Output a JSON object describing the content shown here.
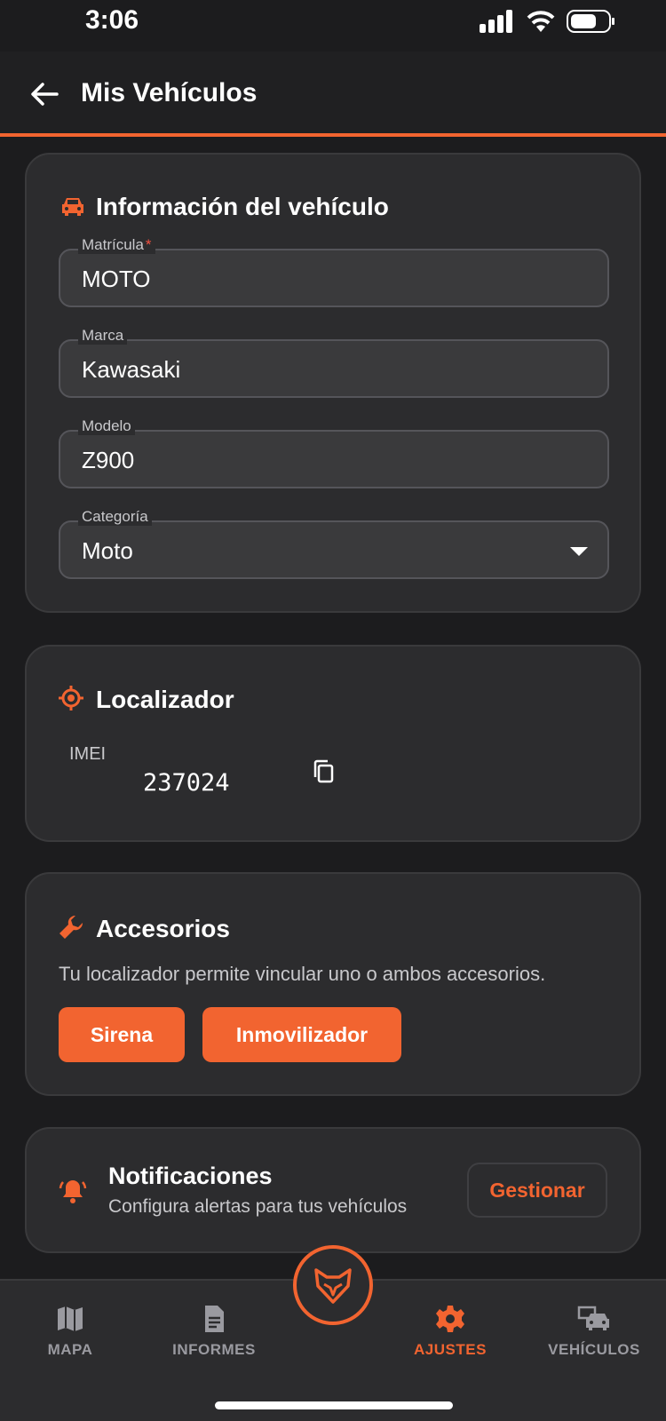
{
  "status_bar": {
    "time": "3:06"
  },
  "app_bar": {
    "title": "Mis Vehículos"
  },
  "vehicle_info": {
    "title": "Información del vehículo",
    "fields": {
      "plate": {
        "label": "Matrícula",
        "required_mark": "*",
        "value": "MOTO"
      },
      "brand": {
        "label": "Marca",
        "value": "Kawasaki"
      },
      "model": {
        "label": "Modelo",
        "value": "Z900"
      },
      "category": {
        "label": "Categoría",
        "value": "Moto"
      }
    }
  },
  "locator": {
    "title": "Localizador",
    "imei_label": "IMEI",
    "imei_value": "237024"
  },
  "accessories": {
    "title": "Accesorios",
    "description": "Tu localizador permite vincular uno o ambos accesorios.",
    "buttons": {
      "siren": "Sirena",
      "immobilizer": "Inmovilizador"
    }
  },
  "notifications": {
    "title": "Notificaciones",
    "subtitle": "Configura alertas para tus vehículos",
    "manage_label": "Gestionar"
  },
  "bottom_nav": {
    "items": [
      {
        "label": "MAPA",
        "icon": "map-icon",
        "active": false
      },
      {
        "label": "INFORMES",
        "icon": "document-icon",
        "active": false
      },
      {
        "label": "AJUSTES",
        "icon": "gear-icon",
        "active": true
      },
      {
        "label": "VEHÍCULOS",
        "icon": "vehicles-icon",
        "active": false
      }
    ]
  },
  "colors": {
    "accent": "#f26430",
    "background": "#1c1c1e",
    "card": "#2c2c2e",
    "field": "#3a3a3c",
    "text_secondary": "#c9c9cc"
  }
}
